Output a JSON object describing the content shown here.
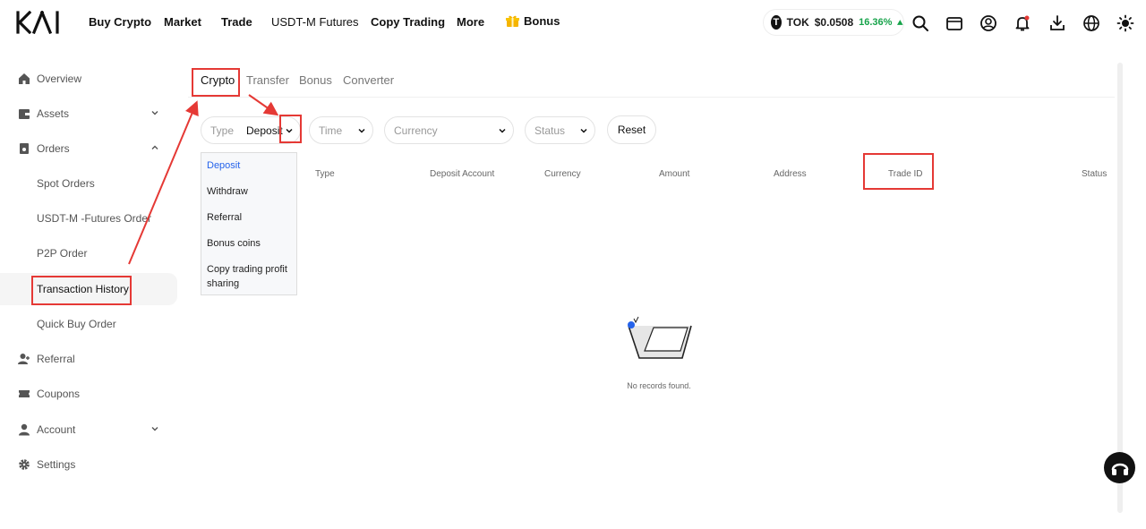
{
  "logo": "KAI",
  "nav": {
    "items": [
      "Buy Crypto",
      "Market",
      "Trade",
      "USDT-M Futures",
      "Copy Trading",
      "More",
      "Bonus"
    ]
  },
  "ticker": {
    "symbol": "TOK",
    "price": "$0.0508",
    "change": "16.36%"
  },
  "sidebar": {
    "items": [
      {
        "label": "Overview",
        "icon": "home-icon"
      },
      {
        "label": "Assets",
        "icon": "wallet-icon"
      },
      {
        "label": "Orders",
        "icon": "orders-icon"
      },
      {
        "label": "Spot Orders"
      },
      {
        "label": "USDT-M -Futures Order"
      },
      {
        "label": "P2P Order"
      },
      {
        "label": "Transaction History"
      },
      {
        "label": "Quick Buy Order"
      },
      {
        "label": "Referral",
        "icon": "add-user-icon"
      },
      {
        "label": "Coupons",
        "icon": "ticket-icon"
      },
      {
        "label": "Account",
        "icon": "user-icon"
      },
      {
        "label": "Settings",
        "icon": "gear-icon"
      }
    ]
  },
  "tabs": [
    "Crypto",
    "Transfer",
    "Bonus",
    "Converter"
  ],
  "filters": {
    "type_label": "Type",
    "type_value": "Deposit",
    "time_placeholder": "Time",
    "currency_placeholder": "Currency",
    "status_placeholder": "Status",
    "reset_label": "Reset"
  },
  "type_options": [
    "Deposit",
    "Withdraw",
    "Referral",
    "Bonus coins",
    "Copy trading profit sharing"
  ],
  "table": {
    "columns": [
      "Type",
      "Deposit Account",
      "Currency",
      "Amount",
      "Address",
      "Trade ID",
      "Status"
    ]
  },
  "empty_text": "No records found.",
  "colors": {
    "accent": "#2563eb",
    "up": "#16a34a",
    "annotation": "#e53935"
  }
}
